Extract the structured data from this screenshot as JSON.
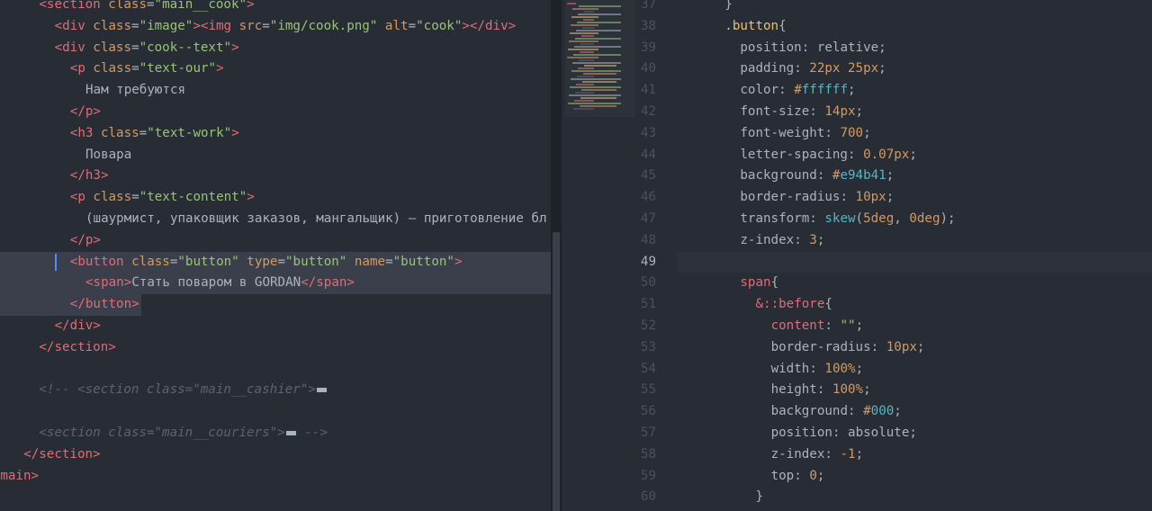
{
  "left_code": [
    {
      "indent": 2,
      "tokens": [
        [
          "tag",
          "<section"
        ],
        [
          "attr",
          " class"
        ],
        [
          "punct",
          "="
        ],
        [
          "str",
          "\"main__cook\""
        ],
        [
          "tag",
          ">"
        ]
      ]
    },
    {
      "indent": 3,
      "tokens": [
        [
          "tag",
          "<div"
        ],
        [
          "attr",
          " class"
        ],
        [
          "punct",
          "="
        ],
        [
          "str",
          "\"image\""
        ],
        [
          "tag",
          "><img"
        ],
        [
          "attr",
          " src"
        ],
        [
          "punct",
          "="
        ],
        [
          "str",
          "\"img/cook.png\""
        ],
        [
          "attr",
          " alt"
        ],
        [
          "punct",
          "="
        ],
        [
          "str",
          "\"cook\""
        ],
        [
          "tag",
          "></div>"
        ]
      ]
    },
    {
      "indent": 3,
      "tokens": [
        [
          "tag",
          "<div"
        ],
        [
          "attr",
          " class"
        ],
        [
          "punct",
          "="
        ],
        [
          "str",
          "\"cook--text\""
        ],
        [
          "tag",
          ">"
        ]
      ]
    },
    {
      "indent": 4,
      "tokens": [
        [
          "tag",
          "<p"
        ],
        [
          "attr",
          " class"
        ],
        [
          "punct",
          "="
        ],
        [
          "str",
          "\"text-our\""
        ],
        [
          "tag",
          ">"
        ]
      ]
    },
    {
      "indent": 5,
      "tokens": [
        [
          "txt",
          "Нам требуются"
        ]
      ]
    },
    {
      "indent": 4,
      "tokens": [
        [
          "tag",
          "</p>"
        ]
      ]
    },
    {
      "indent": 4,
      "tokens": [
        [
          "tag",
          "<h3"
        ],
        [
          "attr",
          " class"
        ],
        [
          "punct",
          "="
        ],
        [
          "str",
          "\"text-work\""
        ],
        [
          "tag",
          ">"
        ]
      ]
    },
    {
      "indent": 5,
      "tokens": [
        [
          "txt",
          "Повара"
        ]
      ]
    },
    {
      "indent": 4,
      "tokens": [
        [
          "tag",
          "</h3>"
        ]
      ]
    },
    {
      "indent": 4,
      "tokens": [
        [
          "tag",
          "<p"
        ],
        [
          "attr",
          " class"
        ],
        [
          "punct",
          "="
        ],
        [
          "str",
          "\"text-content\""
        ],
        [
          "tag",
          ">"
        ]
      ]
    },
    {
      "indent": 5,
      "tokens": [
        [
          "txt",
          "(шаурмист, упаковщик заказов, мангальщик) – приготовление бл"
        ]
      ]
    },
    {
      "indent": 4,
      "tokens": [
        [
          "tag",
          "</p>"
        ]
      ]
    },
    {
      "indent": 4,
      "highlight": true,
      "cursor": true,
      "tokens": [
        [
          "tag",
          "<button"
        ],
        [
          "attr",
          " class"
        ],
        [
          "punct",
          "="
        ],
        [
          "str",
          "\"button\""
        ],
        [
          "attr",
          " type"
        ],
        [
          "punct",
          "="
        ],
        [
          "str",
          "\"button\""
        ],
        [
          "attr",
          " name"
        ],
        [
          "punct",
          "="
        ],
        [
          "str",
          "\"button\""
        ],
        [
          "tag",
          ">"
        ]
      ]
    },
    {
      "indent": 5,
      "highlight": true,
      "tokens": [
        [
          "tag",
          "<span"
        ],
        [
          "tag",
          ">"
        ],
        [
          "txt",
          "Стать поваром в GORDAN"
        ],
        [
          "tag",
          "</span>"
        ]
      ]
    },
    {
      "indent": 4,
      "highlight_partial": true,
      "tokens": [
        [
          "tag",
          "</button>"
        ]
      ]
    },
    {
      "indent": 3,
      "tokens": [
        [
          "tag",
          "</div>"
        ]
      ]
    },
    {
      "indent": 2,
      "tokens": [
        [
          "tag",
          "</section>"
        ]
      ]
    },
    {
      "indent": 0,
      "tokens": []
    },
    {
      "indent": 2,
      "tokens": [
        [
          "comment",
          "<!-- <section class=\"main__cashier\">"
        ],
        [
          "fold",
          ""
        ]
      ]
    },
    {
      "indent": 0,
      "tokens": []
    },
    {
      "indent": 2,
      "tokens": [
        [
          "comment",
          "<section class=\"main__couriers\">"
        ],
        [
          "fold",
          ""
        ],
        [
          "comment",
          " -->"
        ]
      ]
    },
    {
      "indent": 1,
      "tokens": [
        [
          "tag",
          "</section>"
        ]
      ]
    },
    {
      "indent": -1,
      "tokens": [
        [
          "tag",
          "/main>"
        ]
      ]
    }
  ],
  "right_code": [
    {
      "num": "37",
      "indent": 3,
      "tokens": [
        [
          "punct",
          "}"
        ]
      ]
    },
    {
      "num": "38",
      "indent": 3,
      "tokens": [
        [
          "sel",
          ".button"
        ],
        [
          "punct",
          "{"
        ]
      ]
    },
    {
      "num": "39",
      "indent": 4,
      "tokens": [
        [
          "prop",
          "position"
        ],
        [
          "punct",
          ": "
        ],
        [
          "prop",
          "relative"
        ],
        [
          "punct",
          ";"
        ]
      ]
    },
    {
      "num": "40",
      "indent": 4,
      "tokens": [
        [
          "prop",
          "padding"
        ],
        [
          "punct",
          ": "
        ],
        [
          "num",
          "22px 25px"
        ],
        [
          "punct",
          ";"
        ]
      ]
    },
    {
      "num": "41",
      "indent": 4,
      "tokens": [
        [
          "prop",
          "color"
        ],
        [
          "punct",
          ": "
        ],
        [
          "num",
          "#"
        ],
        [
          "color",
          "ffffff"
        ],
        [
          "punct",
          ";"
        ]
      ]
    },
    {
      "num": "42",
      "indent": 4,
      "tokens": [
        [
          "prop",
          "font-size"
        ],
        [
          "punct",
          ": "
        ],
        [
          "num",
          "14px"
        ],
        [
          "punct",
          ";"
        ]
      ]
    },
    {
      "num": "43",
      "indent": 4,
      "tokens": [
        [
          "prop",
          "font-weight"
        ],
        [
          "punct",
          ": "
        ],
        [
          "num",
          "700"
        ],
        [
          "punct",
          ";"
        ]
      ]
    },
    {
      "num": "44",
      "indent": 4,
      "tokens": [
        [
          "prop",
          "letter-spacing"
        ],
        [
          "punct",
          ": "
        ],
        [
          "num",
          "0.07px"
        ],
        [
          "punct",
          ";"
        ]
      ]
    },
    {
      "num": "45",
      "indent": 4,
      "tokens": [
        [
          "prop",
          "background"
        ],
        [
          "punct",
          ": "
        ],
        [
          "num",
          "#"
        ],
        [
          "color",
          "e94b41"
        ],
        [
          "punct",
          ";"
        ]
      ]
    },
    {
      "num": "46",
      "indent": 4,
      "tokens": [
        [
          "prop",
          "border-radius"
        ],
        [
          "punct",
          ": "
        ],
        [
          "num",
          "10px"
        ],
        [
          "punct",
          ";"
        ]
      ]
    },
    {
      "num": "47",
      "indent": 4,
      "tokens": [
        [
          "prop",
          "transform"
        ],
        [
          "punct",
          ": "
        ],
        [
          "fn",
          "skew"
        ],
        [
          "punct",
          "("
        ],
        [
          "num",
          "5deg"
        ],
        [
          "punct",
          ", "
        ],
        [
          "num",
          "0deg"
        ],
        [
          "punct",
          ");"
        ]
      ]
    },
    {
      "num": "48",
      "indent": 4,
      "tokens": [
        [
          "prop",
          "z-index"
        ],
        [
          "punct",
          ": "
        ],
        [
          "num",
          "3"
        ],
        [
          "punct",
          ";"
        ]
      ]
    },
    {
      "num": "49",
      "indent": 0,
      "current": true,
      "tokens": []
    },
    {
      "num": "50",
      "indent": 4,
      "tokens": [
        [
          "red",
          "span"
        ],
        [
          "punct",
          "{"
        ]
      ]
    },
    {
      "num": "51",
      "indent": 5,
      "tokens": [
        [
          "red",
          "&::before"
        ],
        [
          "punct",
          "{"
        ]
      ]
    },
    {
      "num": "52",
      "indent": 6,
      "tokens": [
        [
          "red",
          "content"
        ],
        [
          "punct",
          ": "
        ],
        [
          "str",
          "\"\""
        ],
        [
          "punct",
          ";"
        ]
      ]
    },
    {
      "num": "53",
      "indent": 6,
      "tokens": [
        [
          "prop",
          "border-radius"
        ],
        [
          "punct",
          ": "
        ],
        [
          "num",
          "10px"
        ],
        [
          "punct",
          ";"
        ]
      ]
    },
    {
      "num": "54",
      "indent": 6,
      "tokens": [
        [
          "prop",
          "width"
        ],
        [
          "punct",
          ": "
        ],
        [
          "num",
          "100%"
        ],
        [
          "punct",
          ";"
        ]
      ]
    },
    {
      "num": "55",
      "indent": 6,
      "tokens": [
        [
          "prop",
          "height"
        ],
        [
          "punct",
          ": "
        ],
        [
          "num",
          "100%"
        ],
        [
          "punct",
          ";"
        ]
      ]
    },
    {
      "num": "56",
      "indent": 6,
      "tokens": [
        [
          "prop",
          "background"
        ],
        [
          "punct",
          ": "
        ],
        [
          "num",
          "#"
        ],
        [
          "color",
          "000"
        ],
        [
          "punct",
          ";"
        ]
      ]
    },
    {
      "num": "57",
      "indent": 6,
      "tokens": [
        [
          "prop",
          "position"
        ],
        [
          "punct",
          ": "
        ],
        [
          "prop",
          "absolute"
        ],
        [
          "punct",
          ";"
        ]
      ]
    },
    {
      "num": "58",
      "indent": 6,
      "tokens": [
        [
          "prop",
          "z-index"
        ],
        [
          "punct",
          ": "
        ],
        [
          "num",
          "-1"
        ],
        [
          "punct",
          ";"
        ]
      ]
    },
    {
      "num": "59",
      "indent": 6,
      "tokens": [
        [
          "prop",
          "top"
        ],
        [
          "punct",
          ": "
        ],
        [
          "num",
          "0"
        ],
        [
          "punct",
          ";"
        ]
      ]
    },
    {
      "num": "60",
      "indent": 5,
      "tokens": [
        [
          "punct",
          "}"
        ]
      ]
    }
  ]
}
